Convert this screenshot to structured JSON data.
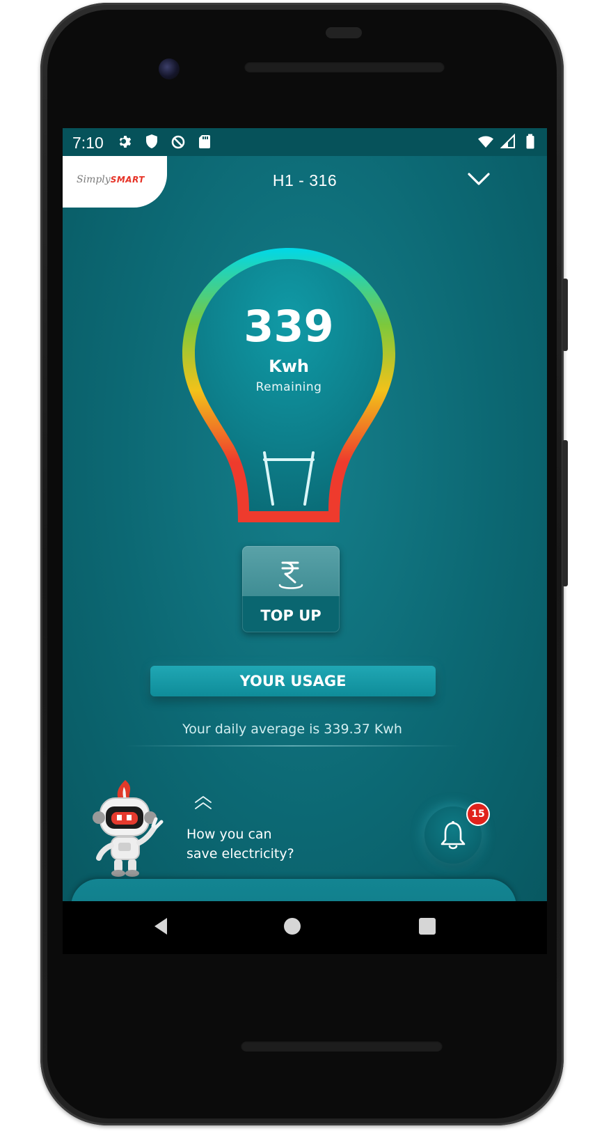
{
  "status_bar": {
    "time": "7:10",
    "left_icons": [
      "gear-icon",
      "shield-icon",
      "data-saver-icon",
      "sd-card-icon"
    ],
    "right_icons": [
      "wifi-icon",
      "signal-icon",
      "battery-icon"
    ]
  },
  "header": {
    "logo_prefix": "Simply",
    "logo_brand": "SMART",
    "meter_id": "H1 - 316"
  },
  "meter": {
    "remaining_value": "339",
    "unit": "Kwh",
    "remaining_label": "Remaining",
    "gauge_colors": [
      "#00d8e8",
      "#7cc83c",
      "#f2c21a",
      "#ee3b2d"
    ]
  },
  "actions": {
    "topup_label": "TOP UP",
    "usage_label": "YOUR USAGE"
  },
  "usage": {
    "daily_average_text": "Your daily average is 339.37 Kwh"
  },
  "tips": {
    "line1": "How you can",
    "line2": "save electricity?"
  },
  "notifications": {
    "count": "15"
  },
  "colors": {
    "background": "#0c6873",
    "accent": "#12909d",
    "badge": "#e0221c"
  }
}
